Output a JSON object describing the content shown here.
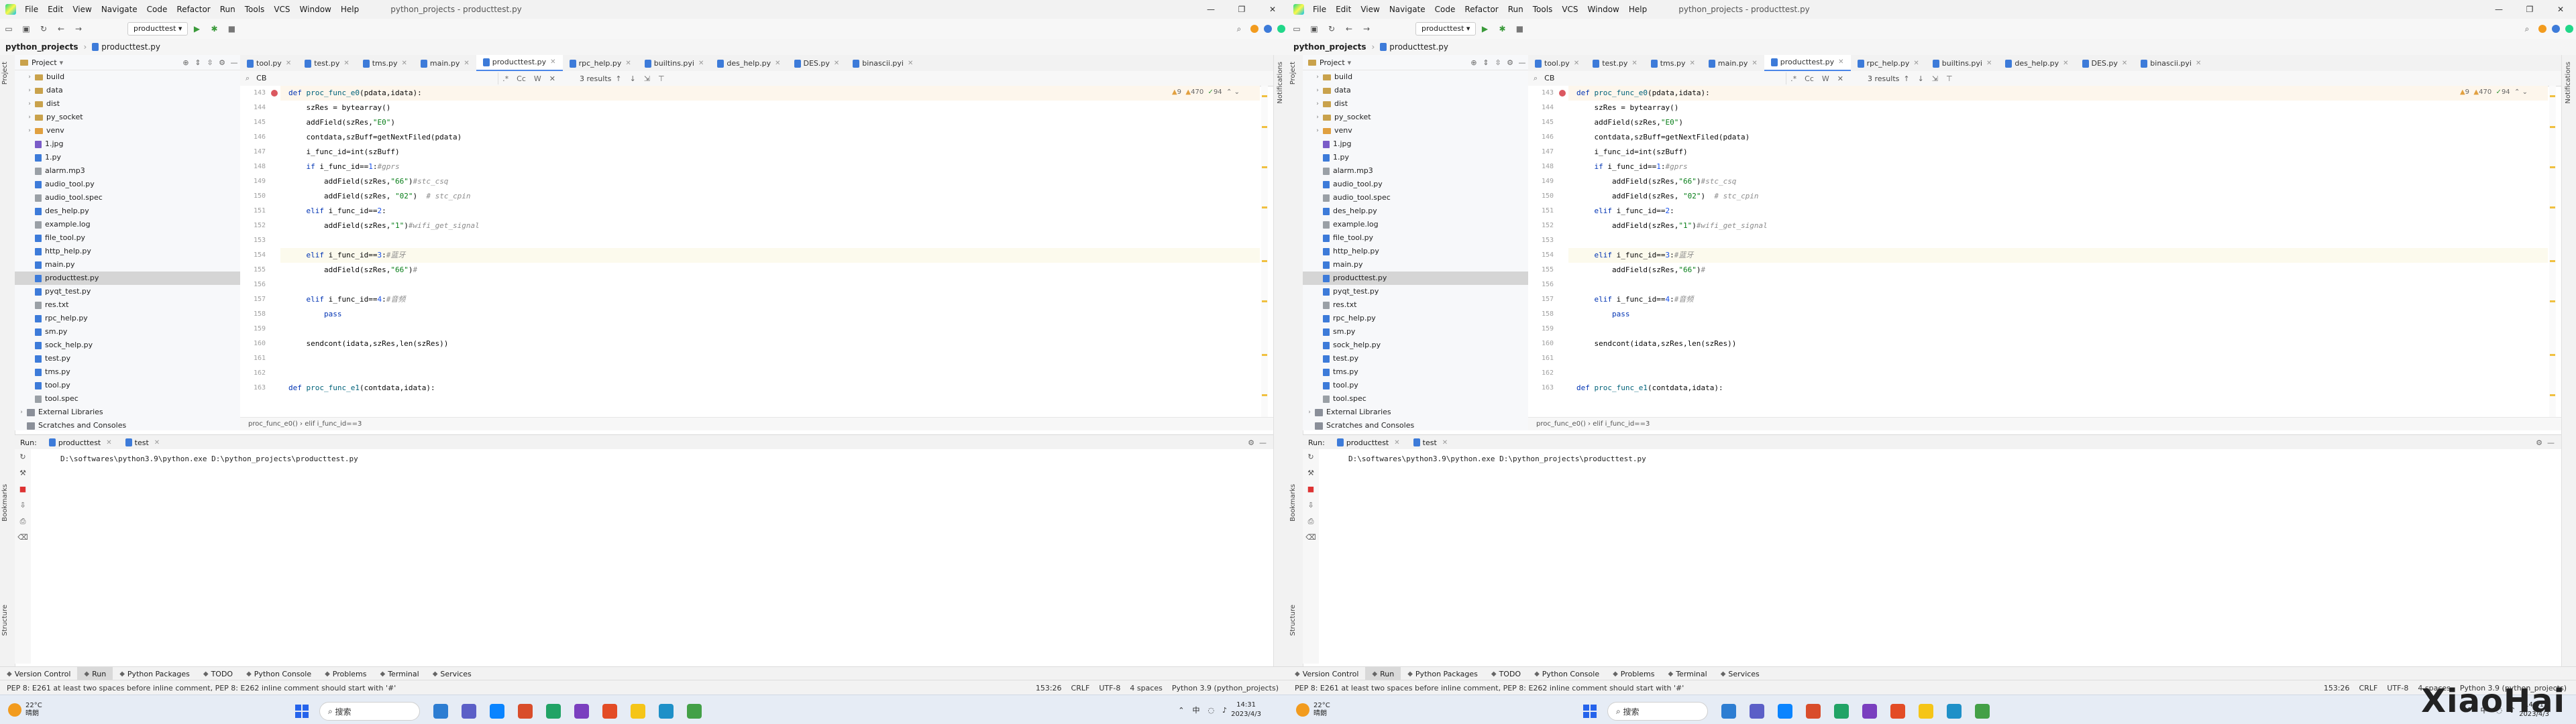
{
  "menu": [
    "File",
    "Edit",
    "View",
    "Navigate",
    "Code",
    "Refactor",
    "Run",
    "Tools",
    "VCS",
    "Window",
    "Help"
  ],
  "window_title": "python_projects - producttest.py",
  "run_config": "producttest",
  "breadcrumb": {
    "root": "python_projects",
    "file": "producttest.py"
  },
  "project_panel": {
    "title": "Project",
    "items": [
      {
        "label": "build",
        "type": "folder",
        "expandable": true
      },
      {
        "label": "data",
        "type": "folder",
        "expandable": true
      },
      {
        "label": "dist",
        "type": "folder",
        "expandable": true
      },
      {
        "label": "py_socket",
        "type": "folder",
        "expandable": true
      },
      {
        "label": "venv",
        "type": "folderx",
        "expandable": true
      },
      {
        "label": "1.jpg",
        "type": "img"
      },
      {
        "label": "1.py",
        "type": "py"
      },
      {
        "label": "alarm.mp3",
        "type": "txt"
      },
      {
        "label": "audio_tool.py",
        "type": "py"
      },
      {
        "label": "audio_tool.spec",
        "type": "txt"
      },
      {
        "label": "des_help.py",
        "type": "py"
      },
      {
        "label": "example.log",
        "type": "txt"
      },
      {
        "label": "file_tool.py",
        "type": "py"
      },
      {
        "label": "http_help.py",
        "type": "py"
      },
      {
        "label": "main.py",
        "type": "py"
      },
      {
        "label": "producttest.py",
        "type": "py",
        "selected": true
      },
      {
        "label": "pyqt_test.py",
        "type": "py"
      },
      {
        "label": "res.txt",
        "type": "txt"
      },
      {
        "label": "rpc_help.py",
        "type": "py"
      },
      {
        "label": "sm.py",
        "type": "py"
      },
      {
        "label": "sock_help.py",
        "type": "py"
      },
      {
        "label": "test.py",
        "type": "py"
      },
      {
        "label": "tms.py",
        "type": "py"
      },
      {
        "label": "tool.py",
        "type": "py"
      },
      {
        "label": "tool.spec",
        "type": "txt"
      },
      {
        "label": "External Libraries",
        "type": "lib",
        "expandable": true,
        "root": true
      },
      {
        "label": "Scratches and Consoles",
        "type": "lib",
        "root": true
      }
    ]
  },
  "editor_tabs": [
    "tool.py",
    "test.py",
    "tms.py",
    "main.py",
    "producttest.py",
    "rpc_help.py",
    "builtins.pyi",
    "des_help.py",
    "DES.py",
    "binascii.pyi"
  ],
  "active_tab": "producttest.py",
  "find": {
    "query": "CB",
    "results": "3 results"
  },
  "inspections": {
    "warnings": "9",
    "weak_warnings": "470",
    "typos": "94"
  },
  "code": {
    "first_line": 143,
    "lines": [
      {
        "html": "<span class='kw'>def</span> <span class='fn'>proc_func_e0</span>(pdata,idata):",
        "bp": true,
        "hl": true
      },
      {
        "html": "    szRes = bytearray()"
      },
      {
        "html": "    addField(szRes,<span class='str'>\"E0\"</span>)"
      },
      {
        "html": "    contdata,szBuff=getNextFiled(pdata)"
      },
      {
        "html": "    i_func_id=int(szBuff)"
      },
      {
        "html": "    <span class='kw'>if</span> i_func_id==<span class='num'>1</span>:<span class='cmt'>#gprs</span>"
      },
      {
        "html": "        addField(szRes,<span class='str'>\"66\"</span>)<span class='cmt'>#stc_csq</span>"
      },
      {
        "html": "        addField(szRes, <span class='str'>\"02\"</span>)  <span class='cmt'># stc_cpin</span>"
      },
      {
        "html": "    <span class='kw'>elif</span> i_func_id==<span class='num'>2</span>:"
      },
      {
        "html": "        addField(szRes,<span class='str'>\"1\"</span>)<span class='cmt'>#wifi_get_signal</span>"
      },
      {
        "html": ""
      },
      {
        "html": "    <span class='kw'>elif</span> i_func_id==<span class='num'>3</span>:<span class='cmt'>#蓝牙</span>",
        "cur": true
      },
      {
        "html": "        addField(szRes,<span class='str'>\"66\"</span>)<span class='cmt'>#</span>"
      },
      {
        "html": ""
      },
      {
        "html": "    <span class='kw'>elif</span> i_func_id==<span class='num'>4</span>:<span class='cmt'>#音频</span>"
      },
      {
        "html": "        <span class='kw'>pass</span>"
      },
      {
        "html": ""
      },
      {
        "html": "    sendcont(idata,szRes,len(szRes))"
      },
      {
        "html": ""
      },
      {
        "html": ""
      },
      {
        "html": "<span class='kw'>def</span> <span class='fn'>proc_func_e1</span>(contdata,idata):"
      }
    ]
  },
  "editor_breadcrumb": "proc_func_e0()  ›  elif i_func_id==3",
  "run_panel": {
    "label": "Run:",
    "tabs": [
      "producttest",
      "test"
    ],
    "console": "D:\\softwares\\python3.9\\python.exe D:\\python_projects\\producttest.py"
  },
  "bottom_tools": [
    "Version Control",
    "Run",
    "Python Packages",
    "TODO",
    "Python Console",
    "Problems",
    "Terminal",
    "Services"
  ],
  "left_strip": [
    "Project",
    "Bookmarks",
    "Structure"
  ],
  "right_strip": [
    "Notifications"
  ],
  "status": {
    "message": "PEP 8: E261 at least two spaces before inline comment, PEP 8: E262 inline comment should start with '#'",
    "position": "153:26",
    "line_sep": "CRLF",
    "encoding": "UTF-8",
    "indent": "4 spaces",
    "interpreter": "Python 3.9 (python_projects)"
  },
  "taskbar": {
    "temp": "22°C",
    "weather": "晴朗",
    "search": "搜索",
    "input": "中",
    "time": "14:31",
    "date": "2023/4/3"
  },
  "watermark": "XiaoHai"
}
